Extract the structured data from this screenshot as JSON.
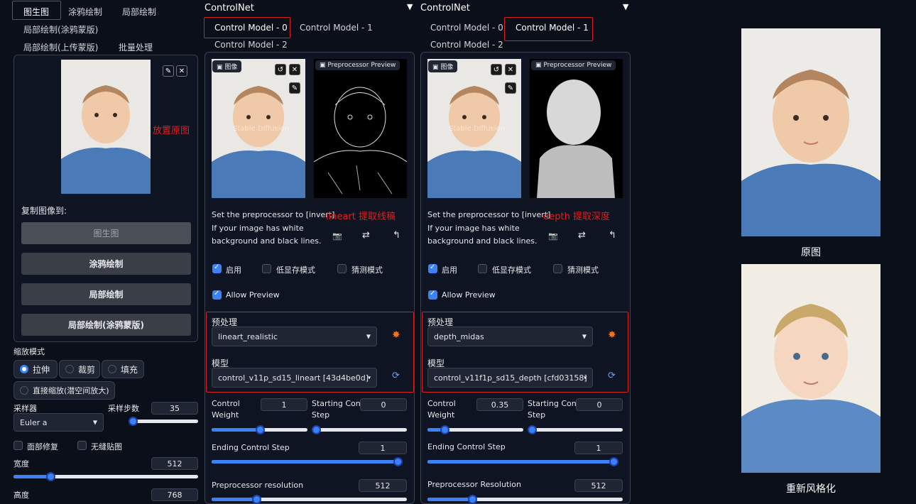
{
  "left": {
    "tabs": [
      "图生图",
      "涂鸦绘制",
      "局部绘制",
      "局部绘制(涂鸦蒙版)",
      "局部绘制(上传蒙版)",
      "批量处理"
    ],
    "annotation_place": "放置原图",
    "copy_to_label": "复制图像到:",
    "copy_buttons": [
      "图生图",
      "涂鸦绘制",
      "局部绘制",
      "局部绘制(涂鸦蒙版)"
    ],
    "resize_mode_label": "缩放模式",
    "resize_options": [
      "拉伸",
      "裁剪",
      "填充",
      "直接缩放(潜空间放大)"
    ],
    "sampler_label": "采样器",
    "sampler_value": "Euler a",
    "steps_label": "采样步数",
    "steps_value": "35",
    "steps_level": 0.06,
    "face_fix_label": "面部修复",
    "tiling_label": "无缝贴图",
    "width_label": "宽度",
    "width_value": "512",
    "width_level": 0.2,
    "height_label": "高度",
    "height_value": "768"
  },
  "cn1": {
    "title": "ControlNet",
    "tabs": [
      "Control Model - 0",
      "Control Model - 1",
      "Control Model - 2"
    ],
    "image_tag": "图像",
    "preview_tag": "Preprocessor Preview",
    "watermark": "Stable Diffusion",
    "hint_line1": "Set the preprocessor to [invert]",
    "hint_line2": "If your image has white",
    "hint_line3": "background and black lines.",
    "annotation": "lineart 提取线稿",
    "enable_label": "启用",
    "lowvram_label": "低显存模式",
    "guess_label": "猜测模式",
    "allow_preview_label": "Allow Preview",
    "preprocessor_label": "预处理",
    "preprocessor_value": "lineart_realistic",
    "model_label": "模型",
    "model_value": "control_v11p_sd15_lineart [43d4be0d]",
    "weight_label1": "Control",
    "weight_label2": "Weight",
    "weight_value": "1",
    "weight_level": 0.5,
    "start_label1": "Starting Control",
    "start_label2": "Step",
    "start_value": "0",
    "start_level": 0.0,
    "end_label": "Ending Control Step",
    "end_value": "1",
    "end_level": 1.0,
    "res_label": "Preprocessor resolution",
    "res_value": "512",
    "res_level": 0.23
  },
  "cn2": {
    "title": "ControlNet",
    "tabs": [
      "Control Model - 0",
      "Control Model - 1",
      "Control Model - 2"
    ],
    "image_tag": "图像",
    "preview_tag": "Preprocessor Preview",
    "watermark": "Stable Diffusion",
    "hint_line1": "Set the preprocessor to [invert]",
    "hint_line2": "If your image has white",
    "hint_line3": "background and black lines.",
    "annotation": "depth 提取深度",
    "enable_label": "启用",
    "lowvram_label": "低显存模式",
    "guess_label": "猜测模式",
    "allow_preview_label": "Allow Preview",
    "preprocessor_label": "预处理",
    "preprocessor_value": "depth_midas",
    "model_label": "模型",
    "model_value": "control_v11f1p_sd15_depth [cfd03158]",
    "weight_label1": "Control",
    "weight_label2": "Weight",
    "weight_value": "0.35",
    "weight_level": 0.18,
    "start_label1": "Starting Control",
    "start_label2": "Step",
    "start_value": "0",
    "start_level": 0.0,
    "end_label": "Ending Control Step",
    "end_value": "1",
    "end_level": 1.0,
    "res_label": "Preprocessor Resolution",
    "res_value": "512",
    "res_level": 0.23
  },
  "right": {
    "caption_original": "原图",
    "caption_restyled": "重新风格化"
  },
  "colors": {
    "accent": "#3b82f6",
    "annotation_red": "#e02020",
    "background": "#0b0f19"
  }
}
